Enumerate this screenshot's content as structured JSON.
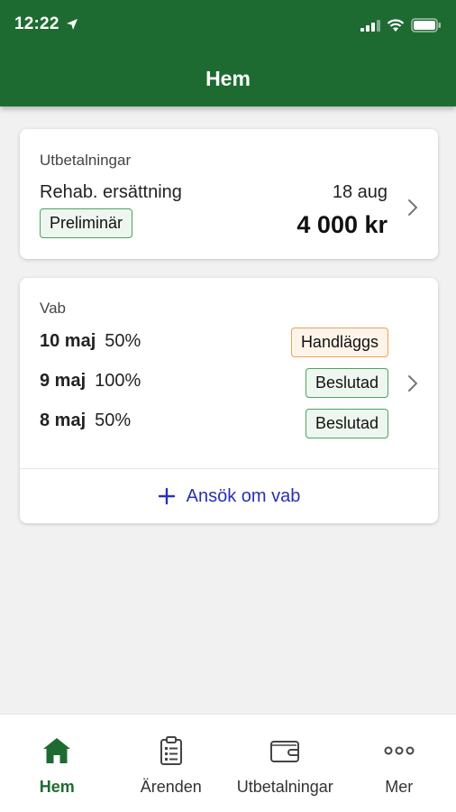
{
  "status_bar": {
    "time": "12:22"
  },
  "header": {
    "title": "Hem"
  },
  "payments_card": {
    "label": "Utbetalningar",
    "name": "Rehab. ersättning",
    "date": "18 aug",
    "status": "Preliminär",
    "amount": "4 000 kr"
  },
  "vab_card": {
    "label": "Vab",
    "rows": [
      {
        "date": "10 maj",
        "percent": "50%",
        "status": "Handläggs"
      },
      {
        "date": "9 maj",
        "percent": "100%",
        "status": "Beslutad"
      },
      {
        "date": "8 maj",
        "percent": "50%",
        "status": "Beslutad"
      }
    ],
    "apply_label": "Ansök om vab"
  },
  "tabbar": {
    "tabs": [
      {
        "label": "Hem",
        "icon": "home-icon",
        "active": true
      },
      {
        "label": "Ärenden",
        "icon": "clipboard-icon",
        "active": false
      },
      {
        "label": "Utbetalningar",
        "icon": "wallet-icon",
        "active": false
      },
      {
        "label": "Mer",
        "icon": "more-icon",
        "active": false
      }
    ]
  },
  "colors": {
    "brand_green": "#1e6b31",
    "link_blue": "#2a2fb5",
    "badge_green_border": "#4ca35f",
    "badge_orange_border": "#f0a058"
  }
}
